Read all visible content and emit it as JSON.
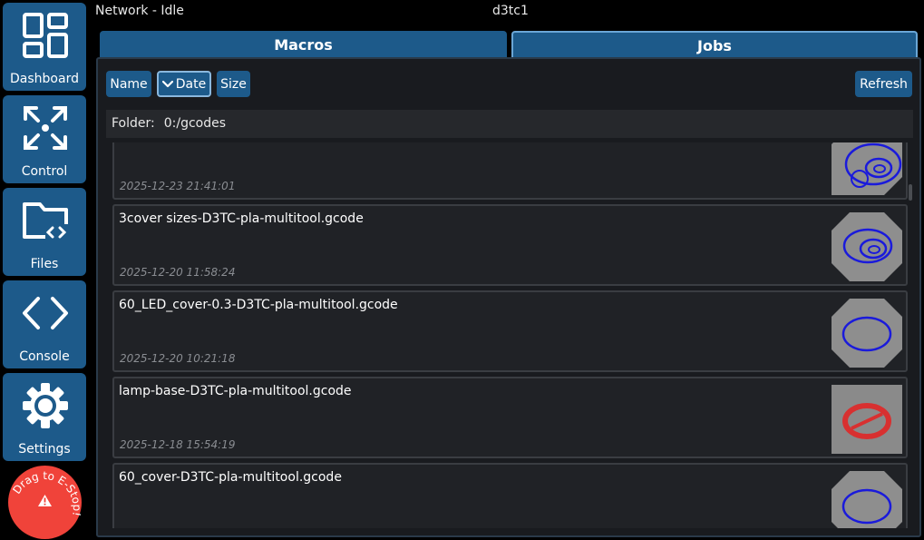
{
  "sidebar": {
    "items": [
      {
        "label": "Dashboard",
        "icon": "dashboard-icon"
      },
      {
        "label": "Control",
        "icon": "move-arrows-icon"
      },
      {
        "label": "Files",
        "icon": "folder-code-icon"
      },
      {
        "label": "Console",
        "icon": "code-brackets-icon"
      },
      {
        "label": "Settings",
        "icon": "gear-icon"
      }
    ],
    "estop_label": "Drag to E-Stop!",
    "estop_icon": "warning-icon"
  },
  "status": {
    "connection": "Network - Idle",
    "machine_name": "d3tc1"
  },
  "tabs": [
    {
      "label": "Macros",
      "active": false
    },
    {
      "label": "Jobs",
      "active": true
    }
  ],
  "toolbar": {
    "sort_buttons": [
      {
        "label": "Name",
        "active": false
      },
      {
        "label": "Date",
        "active": true,
        "icon": "chevron-down-icon"
      },
      {
        "label": "Size",
        "active": false
      }
    ],
    "refresh_label": "Refresh"
  },
  "folder": {
    "label": "Folder:",
    "path": "0:/gcodes"
  },
  "jobs": [
    {
      "name": "",
      "date": "2025-12-23 21:41:01",
      "thumb": "gray-hex-blue-circles"
    },
    {
      "name": "3cover sizes-D3TC-pla-multitool.gcode",
      "date": "2025-12-20 11:58:24",
      "thumb": "gray-hex-blue-circles"
    },
    {
      "name": "60_LED_cover-0.3-D3TC-pla-multitool.gcode",
      "date": "2025-12-20 10:21:18",
      "thumb": "gray-hex-blue-ring"
    },
    {
      "name": "lamp-base-D3TC-pla-multitool.gcode",
      "date": "2025-12-18 15:54:19",
      "thumb": "gray-grid-red-ring"
    },
    {
      "name": "60_cover-D3TC-pla-multitool.gcode",
      "date": "",
      "thumb": "gray-hex-blue-ring"
    }
  ],
  "colors": {
    "accent": "#1d5a8a",
    "estop": "#f0433a",
    "background": "#000000",
    "panel": "#191b1f",
    "item": "#202226"
  }
}
